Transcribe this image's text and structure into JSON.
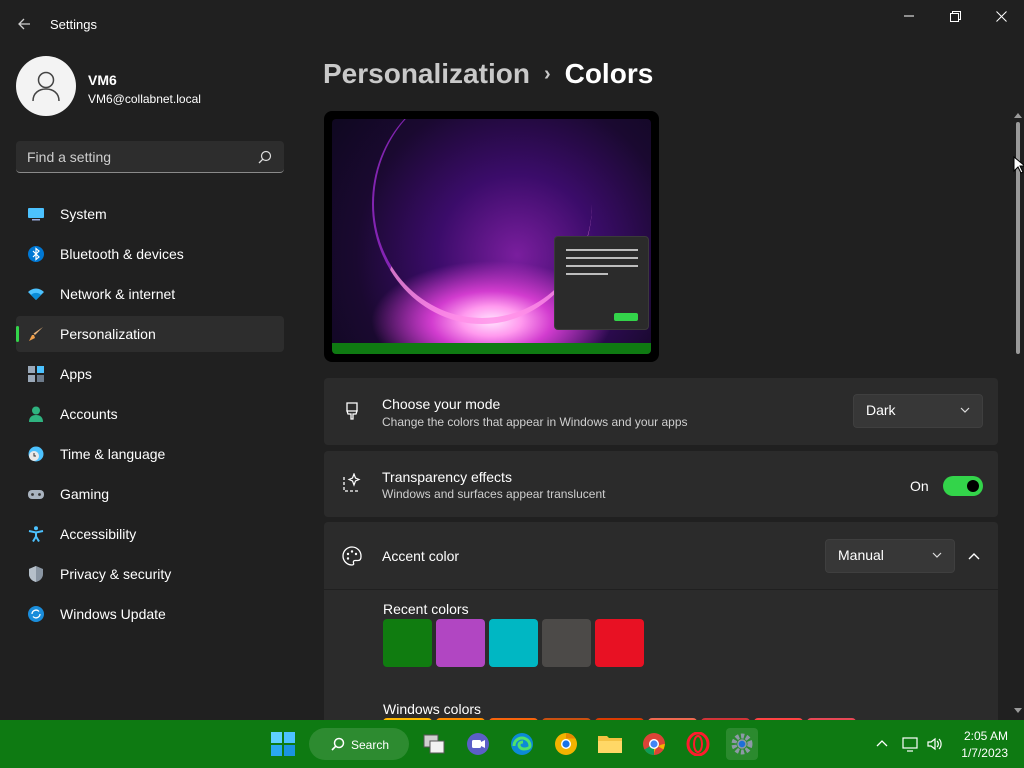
{
  "window": {
    "title": "Settings"
  },
  "profile": {
    "name": "VM6",
    "email": "VM6@collabnet.local"
  },
  "search": {
    "placeholder": "Find a setting"
  },
  "sidebar": {
    "items": [
      {
        "label": "System",
        "icon": "monitor-icon"
      },
      {
        "label": "Bluetooth & devices",
        "icon": "bluetooth-icon"
      },
      {
        "label": "Network & internet",
        "icon": "wifi-icon"
      },
      {
        "label": "Personalization",
        "icon": "brush-icon",
        "active": true
      },
      {
        "label": "Apps",
        "icon": "apps-icon"
      },
      {
        "label": "Accounts",
        "icon": "person-icon"
      },
      {
        "label": "Time & language",
        "icon": "clock-globe-icon"
      },
      {
        "label": "Gaming",
        "icon": "gamepad-icon"
      },
      {
        "label": "Accessibility",
        "icon": "accessibility-icon"
      },
      {
        "label": "Privacy & security",
        "icon": "shield-icon"
      },
      {
        "label": "Windows Update",
        "icon": "update-icon"
      }
    ]
  },
  "breadcrumb": {
    "parent": "Personalization",
    "separator": "›",
    "current": "Colors"
  },
  "mode_card": {
    "title": "Choose your mode",
    "description": "Change the colors that appear in Windows and your apps",
    "value": "Dark"
  },
  "transparency_card": {
    "title": "Transparency effects",
    "description": "Windows and surfaces appear translucent",
    "state_label": "On",
    "enabled": true
  },
  "accent_card": {
    "title": "Accent color",
    "value": "Manual",
    "expanded": true
  },
  "recent_colors": {
    "label": "Recent colors",
    "colors": [
      "#107c10",
      "#b146c2",
      "#00b7c3",
      "#4c4a48",
      "#e81123"
    ]
  },
  "windows_colors": {
    "label": "Windows colors",
    "colors": [
      "#ffb900",
      "#ff8c00",
      "#f7630c",
      "#ca5010",
      "#da3b01",
      "#ef6950",
      "#d13438",
      "#ff4343",
      "#e74856"
    ]
  },
  "taskbar": {
    "search_label": "Search",
    "apps": [
      "windows-start-icon",
      "file-explorer-view-icon",
      "teams-chat-icon",
      "edge-icon",
      "chrome-canary-icon",
      "folder-icon",
      "chrome-icon",
      "opera-icon",
      "settings-gear-icon"
    ],
    "time": "2:05 AM",
    "date": "1/7/2023"
  },
  "colors": {
    "accent": "#33d44a",
    "taskbar": "#0e7a12",
    "background": "#202020",
    "card": "#2b2b2b"
  }
}
